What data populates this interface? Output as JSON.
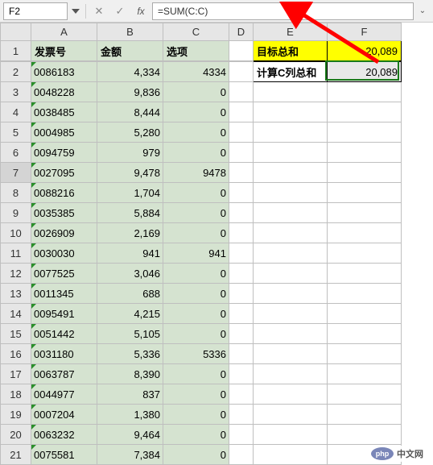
{
  "formula_bar": {
    "name_box": "F2",
    "formula": "=SUM(C:C)"
  },
  "columns": [
    "A",
    "B",
    "C",
    "D",
    "E",
    "F"
  ],
  "headers": {
    "a": "发票号",
    "b": "金额",
    "c": "选项"
  },
  "side_box": {
    "target_label": "目标总和",
    "target_value": "20,089",
    "calc_label": "计算C列总和",
    "calc_value": "20,089"
  },
  "chart_data": {
    "type": "table",
    "columns": [
      "发票号",
      "金额",
      "选项"
    ],
    "rows": [
      [
        "0086183",
        "4,334",
        "4334"
      ],
      [
        "0048228",
        "9,836",
        "0"
      ],
      [
        "0038485",
        "8,444",
        "0"
      ],
      [
        "0004985",
        "5,280",
        "0"
      ],
      [
        "0094759",
        "979",
        "0"
      ],
      [
        "0027095",
        "9,478",
        "9478"
      ],
      [
        "0088216",
        "1,704",
        "0"
      ],
      [
        "0035385",
        "5,884",
        "0"
      ],
      [
        "0026909",
        "2,169",
        "0"
      ],
      [
        "0030030",
        "941",
        "941"
      ],
      [
        "0077525",
        "3,046",
        "0"
      ],
      [
        "0011345",
        "688",
        "0"
      ],
      [
        "0095491",
        "4,215",
        "0"
      ],
      [
        "0051442",
        "5,105",
        "0"
      ],
      [
        "0031180",
        "5,336",
        "5336"
      ],
      [
        "0063787",
        "8,390",
        "0"
      ],
      [
        "0044977",
        "837",
        "0"
      ],
      [
        "0007204",
        "1,380",
        "0"
      ],
      [
        "0063232",
        "9,464",
        "0"
      ],
      [
        "0075581",
        "7,384",
        "0"
      ]
    ]
  },
  "watermark": {
    "brand": "php",
    "text": "中文网"
  },
  "active_cell": "F2",
  "selected_row": 7
}
